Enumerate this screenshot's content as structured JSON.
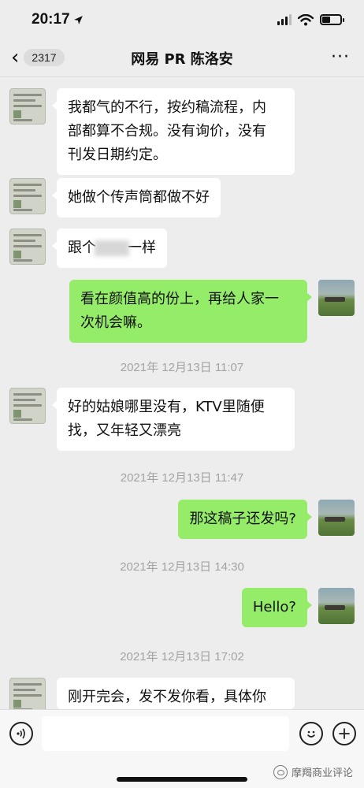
{
  "status_bar": {
    "time": "20:17",
    "location_icon": "location-arrow-icon",
    "signal_icon": "cellular-signal-icon",
    "wifi_icon": "wifi-icon",
    "battery_icon": "battery-icon",
    "battery_level": 0.45
  },
  "nav": {
    "back_icon": "chevron-left-icon",
    "unread_count": "2317",
    "title": "网易 PR 陈洛安",
    "more_icon": "ellipsis-icon"
  },
  "messages": [
    {
      "side": "in",
      "lines": [
        "我都气的不行，按约稿流程，内",
        "部都算不合规。没有询价，没有",
        "刊发日期约定。"
      ]
    },
    {
      "side": "in",
      "lines": [
        "她做个传声筒都做不好"
      ]
    },
    {
      "side": "in",
      "pre": "跟个",
      "post": "一样"
    },
    {
      "side": "out",
      "lines": [
        "看在颜值高的份上，再给人家一",
        "次机会嘛。"
      ]
    },
    {
      "side": "in",
      "lines": [
        "好的姑娘哪里没有，KTV里随便",
        "找，又年轻又漂亮"
      ]
    },
    {
      "side": "out",
      "lines": [
        "那这稿子还发吗?"
      ]
    },
    {
      "side": "out",
      "lines": [
        "Hello?"
      ]
    },
    {
      "side": "in",
      "lines": [
        "刚开完会，发不发你看，具体你"
      ]
    }
  ],
  "timestamps": [
    "2021年 12月13日 11:07",
    "2021年 12月13日 11:47",
    "2021年 12月13日 14:30",
    "2021年 12月13日 17:02"
  ],
  "input_bar": {
    "voice_icon": "voice-icon",
    "emoji_icon": "emoji-icon",
    "plus_icon": "plus-icon",
    "message_value": ""
  },
  "watermark": {
    "text": "摩羯商业评论",
    "logo_icon": "wechat-logo-icon"
  }
}
